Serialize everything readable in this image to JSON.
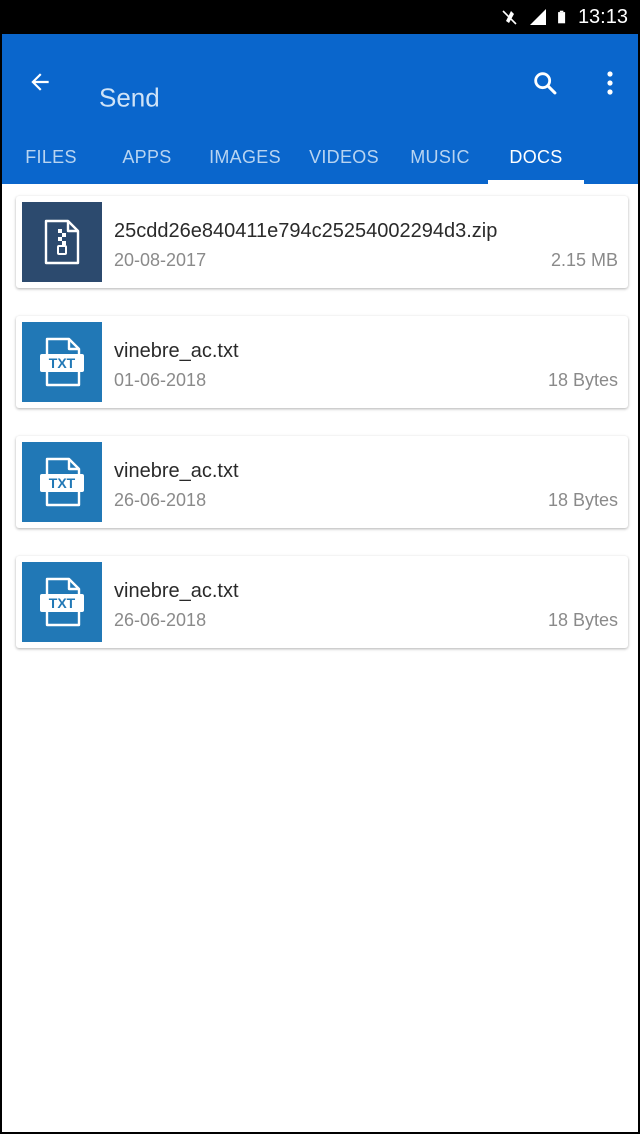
{
  "status_bar": {
    "time": "13:13"
  },
  "app_bar": {
    "title": "Send"
  },
  "tabs": [
    {
      "label": "FILES"
    },
    {
      "label": "APPS"
    },
    {
      "label": "IMAGES"
    },
    {
      "label": "VIDEOS"
    },
    {
      "label": "MUSIC"
    },
    {
      "label": "DOCS"
    }
  ],
  "active_tab": "DOCS",
  "files": [
    {
      "name": "25cdd26e840411e794c25254002294d3.zip",
      "date": "20-08-2017",
      "size": "2.15 MB",
      "type": "zip",
      "icon": "zip-file-icon"
    },
    {
      "name": "vinebre_ac.txt",
      "date": "01-06-2018",
      "size": "18 Bytes",
      "type": "txt",
      "icon_label": "TXT",
      "icon": "txt-file-icon"
    },
    {
      "name": "vinebre_ac.txt",
      "date": "26-06-2018",
      "size": "18 Bytes",
      "type": "txt",
      "icon_label": "TXT",
      "icon": "txt-file-icon"
    },
    {
      "name": "vinebre_ac.txt",
      "date": "26-06-2018",
      "size": "18 Bytes",
      "type": "txt",
      "icon_label": "TXT",
      "icon": "txt-file-icon"
    }
  ],
  "colors": {
    "primary": "#0a66cc",
    "zip_thumb": "#2c4a6e",
    "txt_thumb": "#2178b6"
  }
}
